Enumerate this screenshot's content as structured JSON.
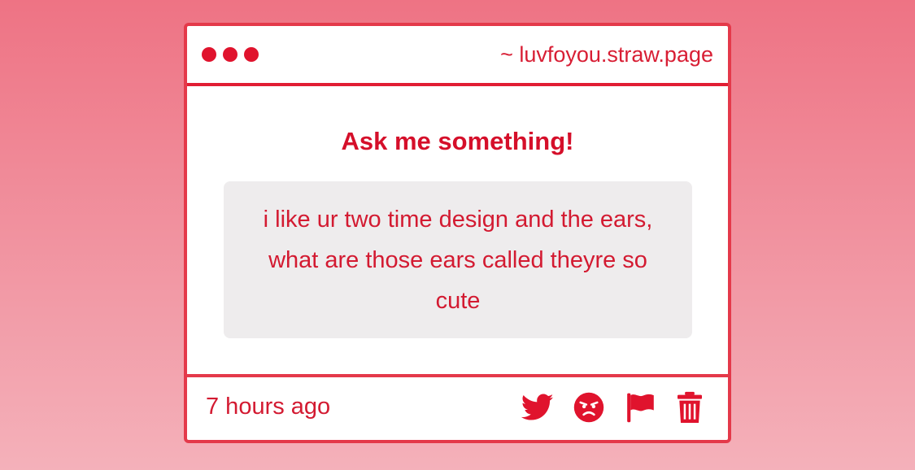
{
  "window": {
    "url": "~ luvfoyou.straw.page",
    "dots": [
      "dot",
      "dot",
      "dot"
    ]
  },
  "main": {
    "heading": "Ask me something!",
    "question": "i like ur two time design and the ears, what are those ears called theyre so cute"
  },
  "footer": {
    "timestamp": "7 hours ago",
    "actions": [
      {
        "name": "twitter-share",
        "icon": "twitter-icon"
      },
      {
        "name": "block-user",
        "icon": "angry-face-icon"
      },
      {
        "name": "report",
        "icon": "flag-icon"
      },
      {
        "name": "delete",
        "icon": "trash-icon"
      }
    ]
  },
  "colors": {
    "accent": "#e0132d",
    "border": "#e4394a",
    "question_bg": "#eeeced",
    "page_gradient_top": "#ee7384",
    "page_gradient_bottom": "#f4b1ba"
  }
}
